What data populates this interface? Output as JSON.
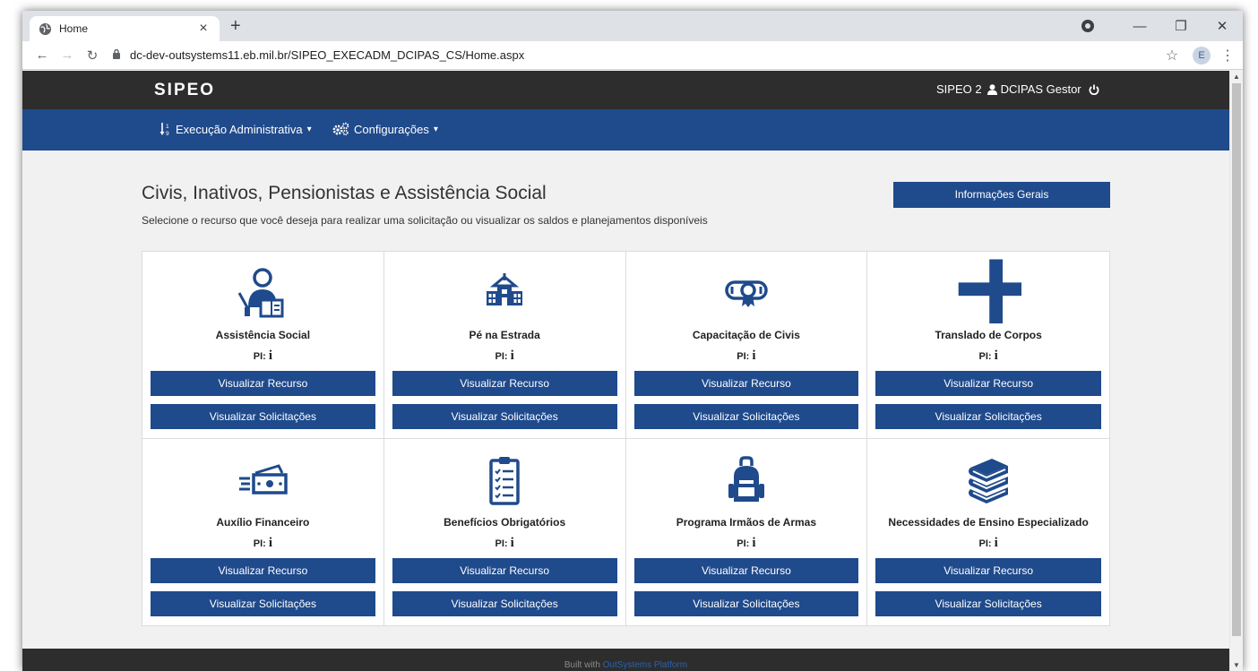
{
  "browser": {
    "tab_title": "Home",
    "url": "dc-dev-outsystems11.eb.mil.br/SIPEO_EXECADM_DCIPAS_CS/Home.aspx",
    "profile_initial": "E"
  },
  "header": {
    "logo_text": "SIPEO",
    "app_version": "SIPEO 2",
    "user_name": "DCIPAS Gestor"
  },
  "menu": {
    "items": [
      {
        "label": "Execução Administrativa"
      },
      {
        "label": "Configurações"
      }
    ]
  },
  "page": {
    "title": "Civis, Inativos, Pensionistas e Assistência Social",
    "subtitle": "Selecione o recurso que você deseja para realizar uma solicitação ou visualizar os saldos e planejamentos disponíveis",
    "info_button": "Informações Gerais"
  },
  "cards": [
    {
      "title": "Assistência Social",
      "pi_label": "PI:",
      "pi_value": "i",
      "icon": "teacher-icon",
      "btn_recurso": "Visualizar Recurso",
      "btn_solicitacoes": "Visualizar Solicitações"
    },
    {
      "title": "Pé na Estrada",
      "pi_label": "PI:",
      "pi_value": "i",
      "icon": "school-icon",
      "btn_recurso": "Visualizar Recurso",
      "btn_solicitacoes": "Visualizar Solicitações"
    },
    {
      "title": "Capacitação de Civis",
      "pi_label": "PI:",
      "pi_value": "i",
      "icon": "certificate-icon",
      "btn_recurso": "Visualizar Recurso",
      "btn_solicitacoes": "Visualizar Solicitações"
    },
    {
      "title": "Translado de Corpos",
      "pi_label": "PI:",
      "pi_value": "i",
      "icon": "cross-icon",
      "btn_recurso": "Visualizar Recurso",
      "btn_solicitacoes": "Visualizar Solicitações"
    },
    {
      "title": "Auxílio Financeiro",
      "pi_label": "PI:",
      "pi_value": "i",
      "icon": "money-icon",
      "btn_recurso": "Visualizar Recurso",
      "btn_solicitacoes": "Visualizar Solicitações"
    },
    {
      "title": "Benefícios Obrigatórios",
      "pi_label": "PI:",
      "pi_value": "i",
      "icon": "clipboard-list-icon",
      "btn_recurso": "Visualizar Recurso",
      "btn_solicitacoes": "Visualizar Solicitações"
    },
    {
      "title": "Programa Irmãos de Armas",
      "pi_label": "PI:",
      "pi_value": "i",
      "icon": "backpack-icon",
      "btn_recurso": "Visualizar Recurso",
      "btn_solicitacoes": "Visualizar Solicitações"
    },
    {
      "title": "Necessidades de Ensino Especializado",
      "pi_label": "PI:",
      "pi_value": "i",
      "icon": "books-icon",
      "btn_recurso": "Visualizar Recurso",
      "btn_solicitacoes": "Visualizar Solicitações"
    }
  ],
  "footer": {
    "built_with": "Built with",
    "platform": "OutSystems Platform"
  },
  "colors": {
    "brand_blue": "#1f4a8c",
    "header_dark": "#2d2d2d",
    "page_bg": "#f1f1f1"
  }
}
